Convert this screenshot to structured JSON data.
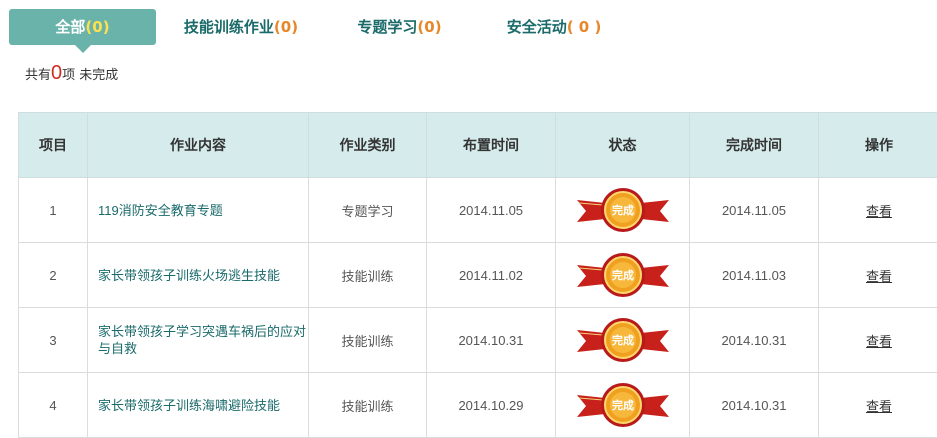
{
  "tabs": [
    {
      "label": "全部",
      "count": "(0)"
    },
    {
      "label": "技能训练作业",
      "count": "(0)"
    },
    {
      "label": "专题学习",
      "count": "(0)"
    },
    {
      "label": "安全活动",
      "count": "( 0 )"
    }
  ],
  "summary": {
    "prefix": "共有",
    "count": "0",
    "suffix": "项 未完成"
  },
  "table": {
    "headers": [
      "项目",
      "作业内容",
      "作业类别",
      "布置时间",
      "状态",
      "完成时间",
      "操作"
    ],
    "rows": [
      {
        "index": "1",
        "content": "119消防安全教育专题",
        "category": "专题学习",
        "assigned": "2014.11.05",
        "status": "完成",
        "completed": "2014.11.05",
        "action": "查看"
      },
      {
        "index": "2",
        "content": "家长带领孩子训练火场逃生技能",
        "category": "技能训练",
        "assigned": "2014.11.02",
        "status": "完成",
        "completed": "2014.11.03",
        "action": "查看"
      },
      {
        "index": "3",
        "content": "家长带领孩子学习突遇车祸后的应对与自救",
        "category": "技能训练",
        "assigned": "2014.10.31",
        "status": "完成",
        "completed": "2014.10.31",
        "action": "查看"
      },
      {
        "index": "4",
        "content": "家长带领孩子训练海啸避险技能",
        "category": "技能训练",
        "assigned": "2014.10.29",
        "status": "完成",
        "completed": "2014.10.31",
        "action": "查看"
      }
    ]
  },
  "colors": {
    "tab_active": "#6ab3aa",
    "count": "#e8862a",
    "header_bg": "#d6ebeb",
    "link": "#1a6a6a",
    "badge_ribbon": "#c8201a",
    "badge_medal": "#f0a020"
  }
}
